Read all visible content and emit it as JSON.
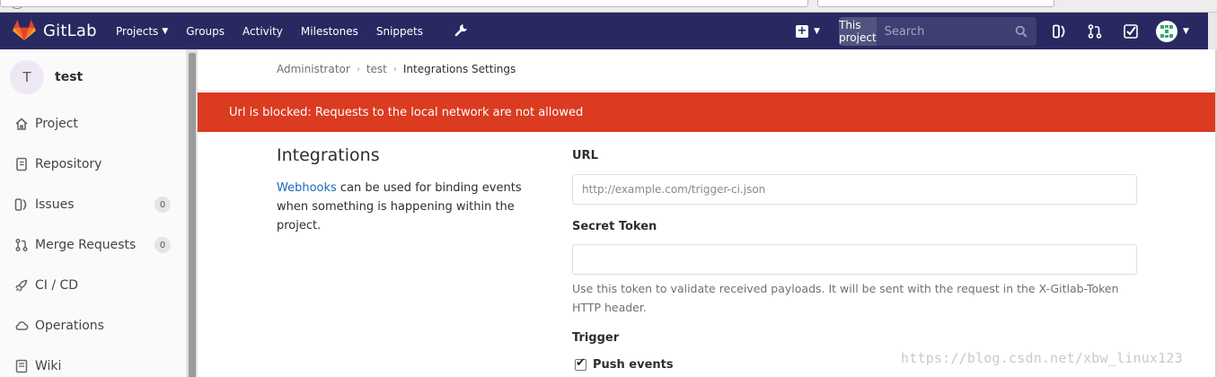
{
  "navbar": {
    "brand": "GitLab",
    "links": [
      {
        "label": "Projects",
        "dropdown": true
      },
      {
        "label": "Groups"
      },
      {
        "label": "Activity"
      },
      {
        "label": "Milestones"
      },
      {
        "label": "Snippets"
      }
    ],
    "search": {
      "scope": "This project",
      "placeholder": "Search"
    },
    "colors": {
      "navbar_bg": "#292961",
      "brand_orange": "#fc6d26"
    }
  },
  "sidebar": {
    "project_initial": "T",
    "project_name": "test",
    "items": [
      {
        "label": "Project",
        "icon": "home-icon"
      },
      {
        "label": "Repository",
        "icon": "book-icon"
      },
      {
        "label": "Issues",
        "icon": "issues-icon",
        "badge": "0"
      },
      {
        "label": "Merge Requests",
        "icon": "merge-request-icon",
        "badge": "0"
      },
      {
        "label": "CI / CD",
        "icon": "rocket-icon"
      },
      {
        "label": "Operations",
        "icon": "cloud-gear-icon"
      },
      {
        "label": "Wiki",
        "icon": "wiki-icon"
      }
    ]
  },
  "breadcrumb": [
    "Administrator",
    "test",
    "Integrations Settings"
  ],
  "alert": {
    "text": "Url is blocked: Requests to the local network are not allowed",
    "color": "#db3b21"
  },
  "settings": {
    "title": "Integrations",
    "desc_link": "Webhooks",
    "desc_rest": " can be used for binding events when something is happening within the project."
  },
  "form": {
    "url_label": "URL",
    "url_placeholder": "http://example.com/trigger-ci.json",
    "token_label": "Secret Token",
    "token_value": "",
    "token_help": "Use this token to validate received payloads. It will be sent with the request in the X-Gitlab-Token HTTP header.",
    "trigger_label": "Trigger",
    "push_events_label": "Push events",
    "push_events_checked": true
  },
  "watermark": "https://blog.csdn.net/xbw_linux123"
}
